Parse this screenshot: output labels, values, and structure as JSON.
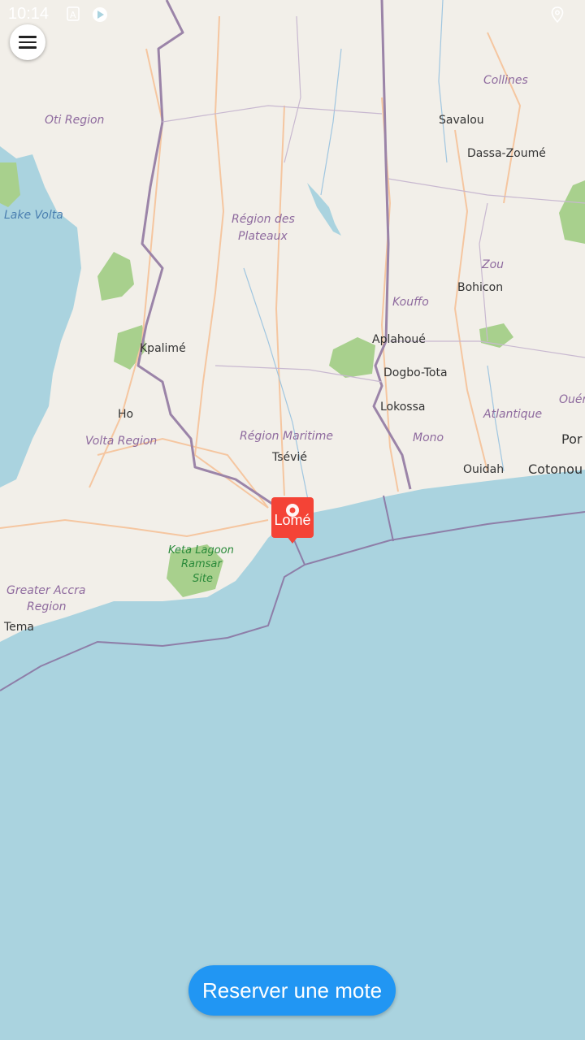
{
  "status_bar": {
    "time": "10:14",
    "icons": [
      "font-icon",
      "play-store-icon",
      "location-icon"
    ]
  },
  "menu_button": {
    "icon": "hamburger-menu-icon"
  },
  "map": {
    "colors": {
      "land": "#f2efe9",
      "sea": "#aad3df",
      "border": "#9b84a8",
      "road": "#f5c6a0",
      "park": "#a8d08d"
    },
    "labels": {
      "oti_region": "Oti Region",
      "lake_volta": "Lake Volta",
      "collines": "Collines",
      "savalou": "Savalou",
      "dassa_zoume": "Dassa-Zoumé",
      "region_plateaux_1": "Région des",
      "region_plateaux_2": "Plateaux",
      "zou": "Zou",
      "bohicon": "Bohicon",
      "kouffo": "Kouffo",
      "aplahoue": "Aplahoué",
      "kpalime": "Kpalimé",
      "dogbo_tota": "Dogbo-Tota",
      "lokossa": "Lokossa",
      "ho": "Ho",
      "atlantique": "Atlantique",
      "oueme": "Ouémé",
      "volta_region": "Volta Region",
      "region_maritime": "Région Maritime",
      "mono": "Mono",
      "porto": "Por",
      "tsevie": "Tsévié",
      "ouidah": "Ouidah",
      "cotonou": "Cotonou",
      "keta_1": "Keta Lagoon",
      "keta_2": "Ramsar",
      "keta_3": "Site",
      "greater_accra_1": "Greater Accra",
      "greater_accra_2": "Region",
      "tema": "Tema"
    }
  },
  "marker": {
    "label": "Lomé",
    "icon": "location-pin-icon",
    "color": "#f44336"
  },
  "reserve_button": {
    "label": "Reserver une mote",
    "color": "#2196f3"
  }
}
